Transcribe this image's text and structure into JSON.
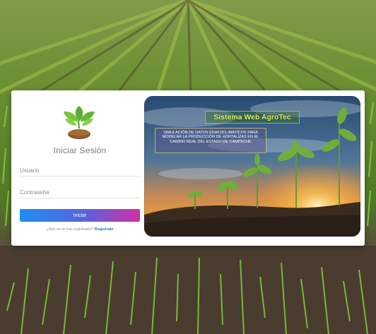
{
  "login": {
    "title": "Iniciar Sesión",
    "username_placeholder": "Usuario",
    "password_placeholder": "Contraseña",
    "submit_label": "Iniciar",
    "signup_prompt": "¿Aún no te has registrado?",
    "signup_link": "Registrate"
  },
  "hero": {
    "title": "Sistema Web AgroTec",
    "description": "SIMULACIÓN DE DATOS EDAFOCLIMÁTICOS PARA MODELAR LA PRODUCCIÓN DE HORTALIZAS EN EL CAMINO REAL DEL ESTADO DE CAMPECHE"
  },
  "colors": {
    "accent_start": "#1f8ff0",
    "accent_end": "#d22fa2",
    "link": "#1a79d6",
    "hero_title": "#d8f25e"
  },
  "icons": {
    "logo": "sprout-in-soil-icon"
  }
}
